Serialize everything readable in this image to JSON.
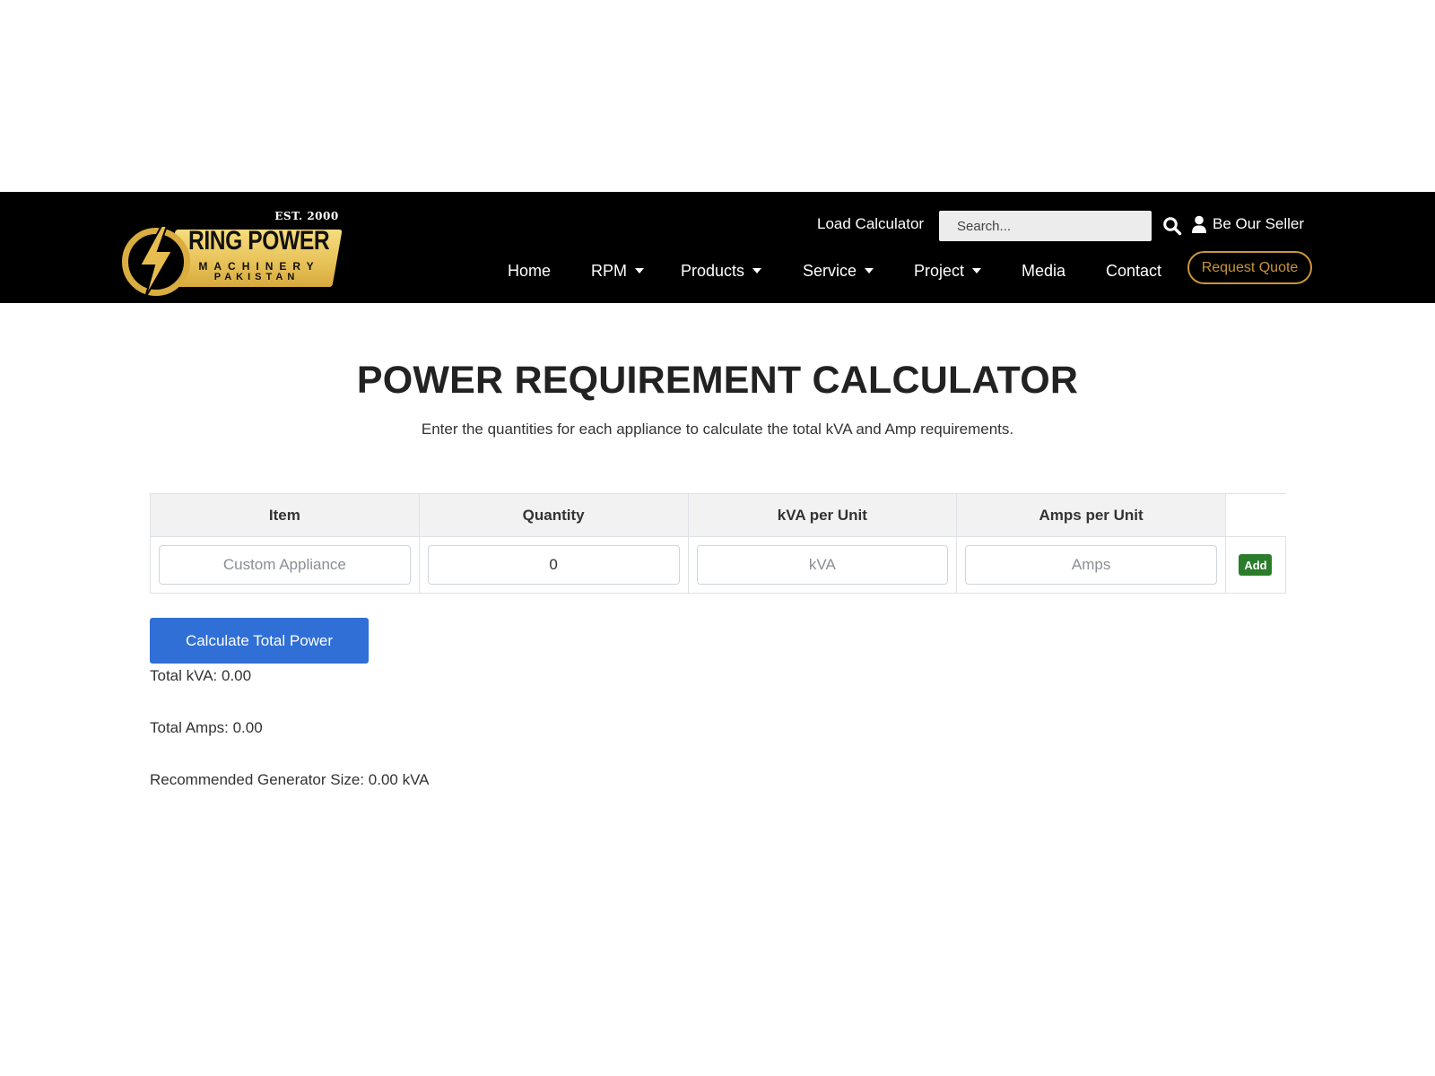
{
  "header": {
    "logo": {
      "est": "EST. 2000",
      "brand": "RING POWER",
      "line2": "MACHINERY",
      "line3": "PAKISTAN"
    },
    "top_link": "Load Calculator",
    "search_placeholder": "Search...",
    "seller_label": "Be Our Seller",
    "nav": [
      {
        "label": "Home",
        "dropdown": false
      },
      {
        "label": "RPM",
        "dropdown": true
      },
      {
        "label": "Products",
        "dropdown": true
      },
      {
        "label": "Service",
        "dropdown": true
      },
      {
        "label": "Project",
        "dropdown": true
      },
      {
        "label": "Media",
        "dropdown": false
      },
      {
        "label": "Contact",
        "dropdown": false
      }
    ],
    "quote_button": "Request Quote"
  },
  "calculator": {
    "title": "POWER REQUIREMENT CALCULATOR",
    "subtitle": "Enter the quantities for each appliance to calculate the total kVA and Amp requirements.",
    "columns": [
      "Item",
      "Quantity",
      "kVA per Unit",
      "Amps per Unit",
      ""
    ],
    "row": {
      "item_placeholder": "Custom Appliance",
      "quantity_value": "0",
      "kva_placeholder": "kVA",
      "amps_placeholder": "Amps",
      "add_label": "Add"
    },
    "calculate_button": "Calculate Total Power",
    "results": {
      "total_kva": "Total kVA: 0.00",
      "total_amps": "Total Amps: 0.00",
      "generator": "Recommended Generator Size: 0.00 kVA"
    }
  },
  "colors": {
    "header_bg": "#000000",
    "accent_gold": "#c8953b",
    "primary_blue": "#2f6fd6",
    "add_green": "#2b7d2b"
  }
}
